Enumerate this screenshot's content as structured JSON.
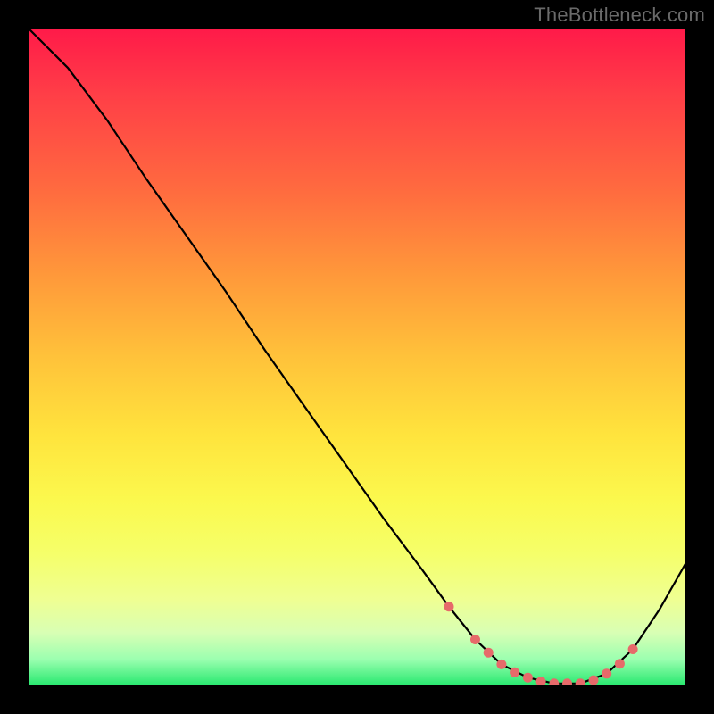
{
  "watermark": "TheBottleneck.com",
  "chart_data": {
    "type": "line",
    "title": "",
    "xlabel": "",
    "ylabel": "",
    "xlim": [
      0,
      100
    ],
    "ylim": [
      0,
      100
    ],
    "series": [
      {
        "name": "curve",
        "x": [
          0,
          6,
          12,
          18,
          24,
          30,
          36,
          42,
          48,
          54,
          60,
          64,
          68,
          72,
          76,
          80,
          84,
          88,
          92,
          96,
          100
        ],
        "y": [
          100,
          94,
          86,
          77,
          68.5,
          60,
          51,
          42.5,
          34,
          25.5,
          17.5,
          12,
          7,
          3.2,
          1.2,
          0.3,
          0.3,
          1.8,
          5.5,
          11.5,
          18.5
        ]
      }
    ],
    "markers": {
      "name": "highlight-points",
      "color": "#e66a6a",
      "x": [
        64,
        68,
        70,
        72,
        74,
        76,
        78,
        80,
        82,
        84,
        86,
        88,
        90,
        92
      ],
      "y": [
        12,
        7,
        5,
        3.2,
        2.0,
        1.2,
        0.6,
        0.3,
        0.3,
        0.3,
        0.8,
        1.8,
        3.3,
        5.5
      ]
    },
    "gradient_bands": [
      {
        "pos": 0.0,
        "color": "#ff1a49"
      },
      {
        "pos": 0.5,
        "color": "#ffc23a"
      },
      {
        "pos": 0.8,
        "color": "#f5ff6a"
      },
      {
        "pos": 1.0,
        "color": "#27e86f"
      }
    ]
  }
}
